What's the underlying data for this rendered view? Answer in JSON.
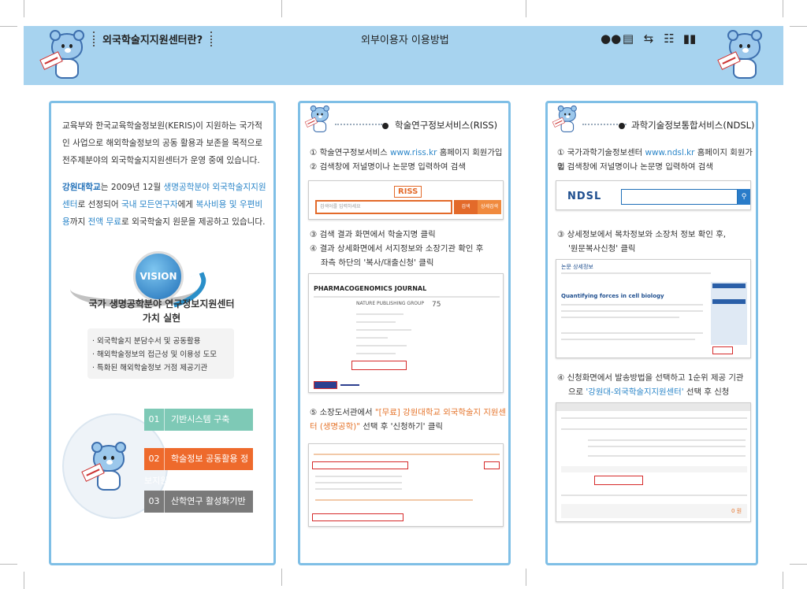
{
  "header": {
    "left_title": "외국학술지지원센터란?",
    "center_title": "외부이용자 이용방법",
    "icons": [
      "users-icon",
      "printer-icon",
      "exchange-icon",
      "document-icon",
      "book-icon"
    ],
    "background": "#a7d3ef"
  },
  "panel1": {
    "intro": "교육부와 한국교육학술정보원(KERIS)이 지원하는 국가적인 사업으로 해외학술정보의 공동 활용과 보존을 목적으로 전주제분야의 외국학술지지원센터가 운영 중에 있습니다.",
    "desc": {
      "org": "강원대학교",
      "t1": "는 2009년 12월 ",
      "field": "생명공학분야 외국학술지지원센터",
      "t2": "로 선정되어 ",
      "target": "국내 모든연구자",
      "t3": "에게 ",
      "cost": "복사비용 및 우편비용",
      "t4": "까지 ",
      "free": "전액 무료",
      "t5": "로 외국학술지 원문을 제공하고 있습니다."
    },
    "vision_label": "VISION",
    "vision_title_1": "국가 생명공학분야 연구정보지원센터",
    "vision_title_2": "가치 실현",
    "vision_items": [
      "· 외국학술지 분담수서 및 공동활용",
      "· 해외학술정보의 접근성 및 이용성 도모",
      "· 특화된 해외학술정보 거점 제공기관"
    ],
    "bars": [
      {
        "num": "01",
        "label": "기반시스템 구축",
        "color": "#7ec9b6"
      },
      {
        "num": "02",
        "label": "학술정보 공동활용 정보지원",
        "color": "#ee6a2c"
      },
      {
        "num": "03",
        "label": "산학연구 활성화기반조성",
        "color": "#7a7a7a"
      }
    ]
  },
  "panel2": {
    "title": "학술연구정보서비스(RISS)",
    "step1_a": "① 학술연구정보서비스 ",
    "step1_url": "www.riss.kr",
    "step1_b": " 홈페이지 회원가입",
    "step2": "② 검색창에 저널명이나 논문명 입력하여 검색",
    "step3": "③ 검색 결과 화면에서 학술지명 클릭",
    "step4a": "④ 결과 상세화면에서 서지정보와 소장기관 확인 후",
    "step4b": "좌측 하단의 '복사/대출신청' 클릭",
    "step5_a": "⑤ 소장도서관에서 ",
    "step5_hl": "\"[무료] 강원대학교 외국학술지 지원센터 (생명공학)\"",
    "step5_b": " 선택 후 '신청하기' 클릭",
    "shot1": {
      "logo": "RISS",
      "search_placeholder": "검색어를 입력하세요",
      "btn1": "검색",
      "btn2": "상세검색"
    },
    "shot2": {
      "journal": "PHARMACOGENOMICS JOURNAL",
      "publisher": "NATURE PUBLISHING GROUP",
      "stat": "75"
    }
  },
  "panel3": {
    "title": "과학기술정보통합서비스(NDSL)",
    "step1_a": "① 국가과학기술정보센터 ",
    "step1_url": "www.ndsl.kr",
    "step1_b": " 홈페이지 회원가입",
    "step2": "② 검색창에 저널명이나 논문명 입력하여 검색",
    "step3a": "③ 상세정보에서 목차정보와 소장처 정보 확인 후,",
    "step3b": "'원문복사신청' 클릭",
    "step4a": "④ 신청화면에서 발송방법을 선택하고 1순위 제공 기관",
    "step4b_a": "으로 ",
    "step4b_hl": "'강원대-외국학술지지원센터'",
    "step4b_b": " 선택 후 신청",
    "shot1": {
      "logo": "NDSL"
    },
    "shot2": {
      "header": "논문 상세정보",
      "article": "Quantifying forces in cell biology"
    },
    "shot3": {
      "total": "0 원"
    }
  }
}
